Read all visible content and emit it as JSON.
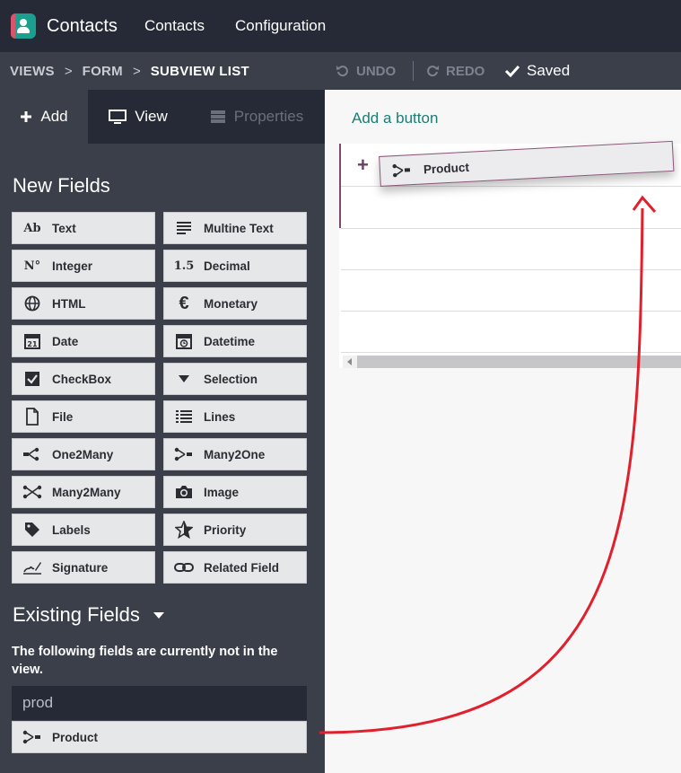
{
  "topnav": {
    "app_name": "Contacts",
    "menu": [
      "Contacts",
      "Configuration"
    ],
    "logo_icon": "contacts-app-icon"
  },
  "breadcrumb": {
    "items": [
      "VIEWS",
      "FORM",
      "SUBVIEW LIST"
    ],
    "separator": ">"
  },
  "toolbar": {
    "undo_label": "UNDO",
    "redo_label": "REDO",
    "saved_label": "Saved"
  },
  "sidebar": {
    "tabs": {
      "add": "Add",
      "view": "View",
      "properties": "Properties"
    },
    "new_fields_title": "New Fields",
    "new_fields": [
      {
        "label": "Text",
        "icon": "text-ab-icon",
        "icon_text": "Ab"
      },
      {
        "label": "Multine Text",
        "icon": "multiline-text-icon"
      },
      {
        "label": "Integer",
        "icon": "integer-icon",
        "icon_text": "N°"
      },
      {
        "label": "Decimal",
        "icon": "decimal-icon",
        "icon_text": "1.5"
      },
      {
        "label": "HTML",
        "icon": "globe-icon"
      },
      {
        "label": "Monetary",
        "icon": "euro-icon"
      },
      {
        "label": "Date",
        "icon": "calendar-icon"
      },
      {
        "label": "Datetime",
        "icon": "calendar-clock-icon"
      },
      {
        "label": "CheckBox",
        "icon": "checkbox-icon"
      },
      {
        "label": "Selection",
        "icon": "caret-down-icon"
      },
      {
        "label": "File",
        "icon": "file-icon"
      },
      {
        "label": "Lines",
        "icon": "list-icon"
      },
      {
        "label": "One2Many",
        "icon": "one2many-icon"
      },
      {
        "label": "Many2One",
        "icon": "many2one-icon"
      },
      {
        "label": "Many2Many",
        "icon": "many2many-icon"
      },
      {
        "label": "Image",
        "icon": "camera-icon"
      },
      {
        "label": "Labels",
        "icon": "tag-icon"
      },
      {
        "label": "Priority",
        "icon": "star-icon"
      },
      {
        "label": "Signature",
        "icon": "signature-icon"
      },
      {
        "label": "Related Field",
        "icon": "link-icon"
      }
    ],
    "existing_fields_title": "Existing Fields",
    "existing_fields_desc": "The following fields are currently not in the view.",
    "search_value": "prod",
    "existing_fields": [
      {
        "label": "Product",
        "icon": "many2one-icon"
      }
    ]
  },
  "main": {
    "add_button_label": "Add a button",
    "dragged_field": {
      "label": "Product",
      "icon": "many2one-icon"
    }
  },
  "colors": {
    "accent_teal": "#1d7c74",
    "accent_purple": "#7a4a6b",
    "arrow_red": "#e0202c"
  }
}
